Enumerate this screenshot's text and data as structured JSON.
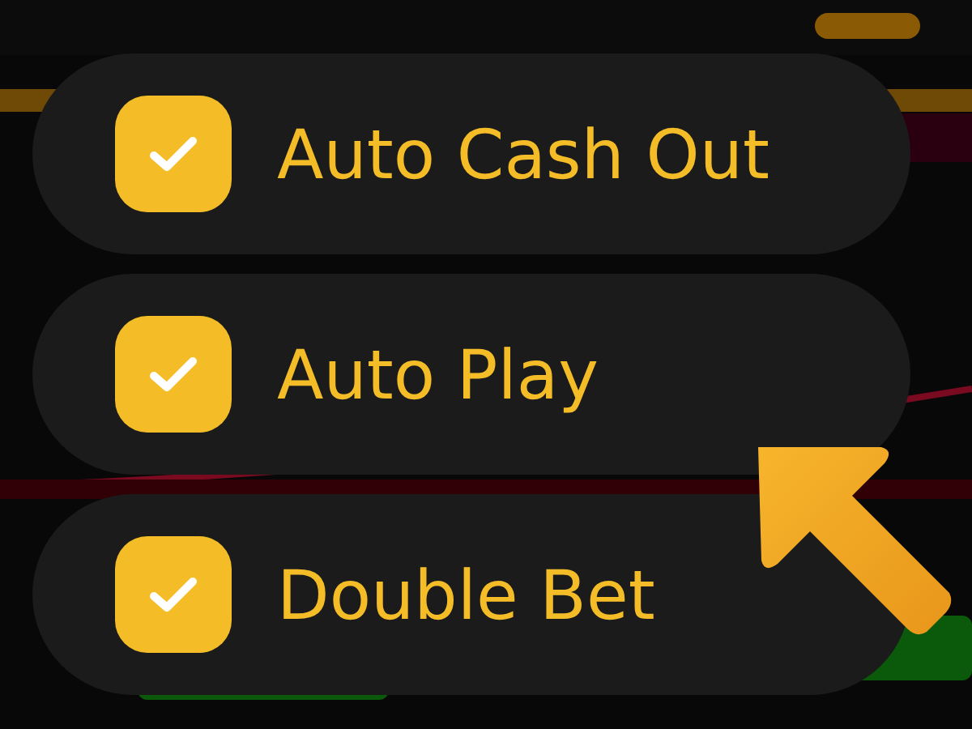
{
  "options": [
    {
      "label": "Auto Cash Out",
      "checked": true
    },
    {
      "label": "Auto Play",
      "checked": true
    },
    {
      "label": "Double Bet",
      "checked": true
    }
  ]
}
